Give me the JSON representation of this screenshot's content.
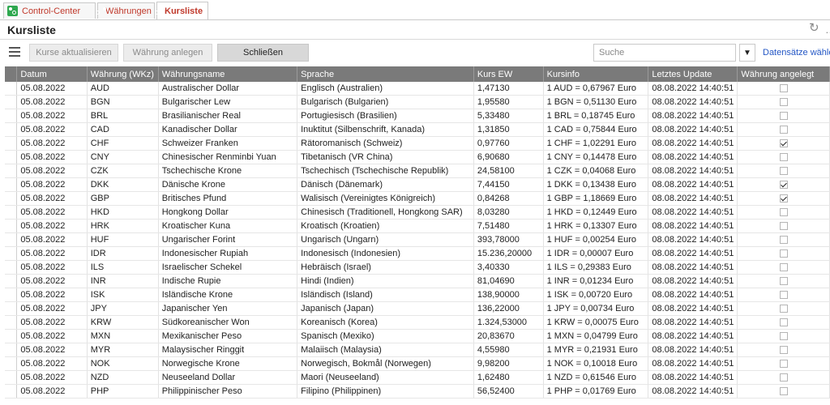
{
  "tabs": [
    {
      "label": "Control-Center",
      "active": false
    },
    {
      "label": "Währungen",
      "active": false
    },
    {
      "label": "Kursliste",
      "active": true
    }
  ],
  "page": {
    "title": "Kursliste"
  },
  "toolbar": {
    "btn_update": "Kurse aktualisieren",
    "btn_create": "Währung anlegen",
    "btn_close": "Schließen",
    "search_placeholder": "Suche",
    "select_records": "Datensätze wählen"
  },
  "colors": {
    "tab_text": "#c0392b",
    "header_bg": "#7a7a7a",
    "link": "#2457c5",
    "tab_icon": "#2fa84f"
  },
  "table": {
    "columns": [
      "Datum",
      "Währung (WKz)",
      "Währungsname",
      "Sprache",
      "Kurs EW",
      "Kursinfo",
      "Letztes Update",
      "Währung angelegt"
    ],
    "rows": [
      [
        "05.08.2022",
        "AUD",
        "Australischer Dollar",
        "Englisch (Australien)",
        "1,47130",
        "1 AUD = 0,67967 Euro",
        "08.08.2022 14:40:51",
        false
      ],
      [
        "05.08.2022",
        "BGN",
        "Bulgarischer Lew",
        "Bulgarisch (Bulgarien)",
        "1,95580",
        "1 BGN = 0,51130 Euro",
        "08.08.2022 14:40:51",
        false
      ],
      [
        "05.08.2022",
        "BRL",
        "Brasilianischer Real",
        "Portugiesisch (Brasilien)",
        "5,33480",
        "1 BRL = 0,18745 Euro",
        "08.08.2022 14:40:51",
        false
      ],
      [
        "05.08.2022",
        "CAD",
        "Kanadischer Dollar",
        "Inuktitut (Silbenschrift, Kanada)",
        "1,31850",
        "1 CAD = 0,75844 Euro",
        "08.08.2022 14:40:51",
        false
      ],
      [
        "05.08.2022",
        "CHF",
        "Schweizer Franken",
        "Rätoromanisch (Schweiz)",
        "0,97760",
        "1 CHF = 1,02291 Euro",
        "08.08.2022 14:40:51",
        true
      ],
      [
        "05.08.2022",
        "CNY",
        "Chinesischer Renminbi Yuan",
        "Tibetanisch (VR China)",
        "6,90680",
        "1 CNY = 0,14478 Euro",
        "08.08.2022 14:40:51",
        false
      ],
      [
        "05.08.2022",
        "CZK",
        "Tschechische Krone",
        "Tschechisch (Tschechische Republik)",
        "24,58100",
        "1 CZK = 0,04068 Euro",
        "08.08.2022 14:40:51",
        false
      ],
      [
        "05.08.2022",
        "DKK",
        "Dänische Krone",
        "Dänisch (Dänemark)",
        "7,44150",
        "1 DKK = 0,13438 Euro",
        "08.08.2022 14:40:51",
        true
      ],
      [
        "05.08.2022",
        "GBP",
        "Britisches Pfund",
        "Walisisch (Vereinigtes Königreich)",
        "0,84268",
        "1 GBP = 1,18669 Euro",
        "08.08.2022 14:40:51",
        true
      ],
      [
        "05.08.2022",
        "HKD",
        "Hongkong Dollar",
        "Chinesisch (Traditionell, Hongkong SAR)",
        "8,03280",
        "1 HKD = 0,12449 Euro",
        "08.08.2022 14:40:51",
        false
      ],
      [
        "05.08.2022",
        "HRK",
        "Kroatischer Kuna",
        "Kroatisch (Kroatien)",
        "7,51480",
        "1 HRK = 0,13307 Euro",
        "08.08.2022 14:40:51",
        false
      ],
      [
        "05.08.2022",
        "HUF",
        "Ungarischer Forint",
        "Ungarisch (Ungarn)",
        "393,78000",
        "1 HUF = 0,00254 Euro",
        "08.08.2022 14:40:51",
        false
      ],
      [
        "05.08.2022",
        "IDR",
        "Indonesischer Rupiah",
        "Indonesisch (Indonesien)",
        "15.236,20000",
        "1 IDR = 0,00007 Euro",
        "08.08.2022 14:40:51",
        false
      ],
      [
        "05.08.2022",
        "ILS",
        "Israelischer Schekel",
        "Hebräisch (Israel)",
        "3,40330",
        "1 ILS = 0,29383 Euro",
        "08.08.2022 14:40:51",
        false
      ],
      [
        "05.08.2022",
        "INR",
        "Indische Rupie",
        "Hindi (Indien)",
        "81,04690",
        "1 INR = 0,01234 Euro",
        "08.08.2022 14:40:51",
        false
      ],
      [
        "05.08.2022",
        "ISK",
        "Isländische Krone",
        "Isländisch (Island)",
        "138,90000",
        "1 ISK = 0,00720 Euro",
        "08.08.2022 14:40:51",
        false
      ],
      [
        "05.08.2022",
        "JPY",
        "Japanischer Yen",
        "Japanisch (Japan)",
        "136,22000",
        "1 JPY = 0,00734 Euro",
        "08.08.2022 14:40:51",
        false
      ],
      [
        "05.08.2022",
        "KRW",
        "Südkoreanischer Won",
        "Koreanisch (Korea)",
        "1.324,53000",
        "1 KRW = 0,00075 Euro",
        "08.08.2022 14:40:51",
        false
      ],
      [
        "05.08.2022",
        "MXN",
        "Mexikanischer Peso",
        "Spanisch (Mexiko)",
        "20,83670",
        "1 MXN = 0,04799 Euro",
        "08.08.2022 14:40:51",
        false
      ],
      [
        "05.08.2022",
        "MYR",
        "Malaysischer Ringgit",
        "Malaiisch (Malaysia)",
        "4,55980",
        "1 MYR = 0,21931 Euro",
        "08.08.2022 14:40:51",
        false
      ],
      [
        "05.08.2022",
        "NOK",
        "Norwegische Krone",
        "Norwegisch, Bokmål (Norwegen)",
        "9,98200",
        "1 NOK = 0,10018 Euro",
        "08.08.2022 14:40:51",
        false
      ],
      [
        "05.08.2022",
        "NZD",
        "Neuseeland Dollar",
        "Maori (Neuseeland)",
        "1,62480",
        "1 NZD = 0,61546 Euro",
        "08.08.2022 14:40:51",
        false
      ],
      [
        "05.08.2022",
        "PHP",
        "Philippinischer Peso",
        "Filipino (Philippinen)",
        "56,52400",
        "1 PHP = 0,01769 Euro",
        "08.08.2022 14:40:51",
        false
      ]
    ]
  }
}
